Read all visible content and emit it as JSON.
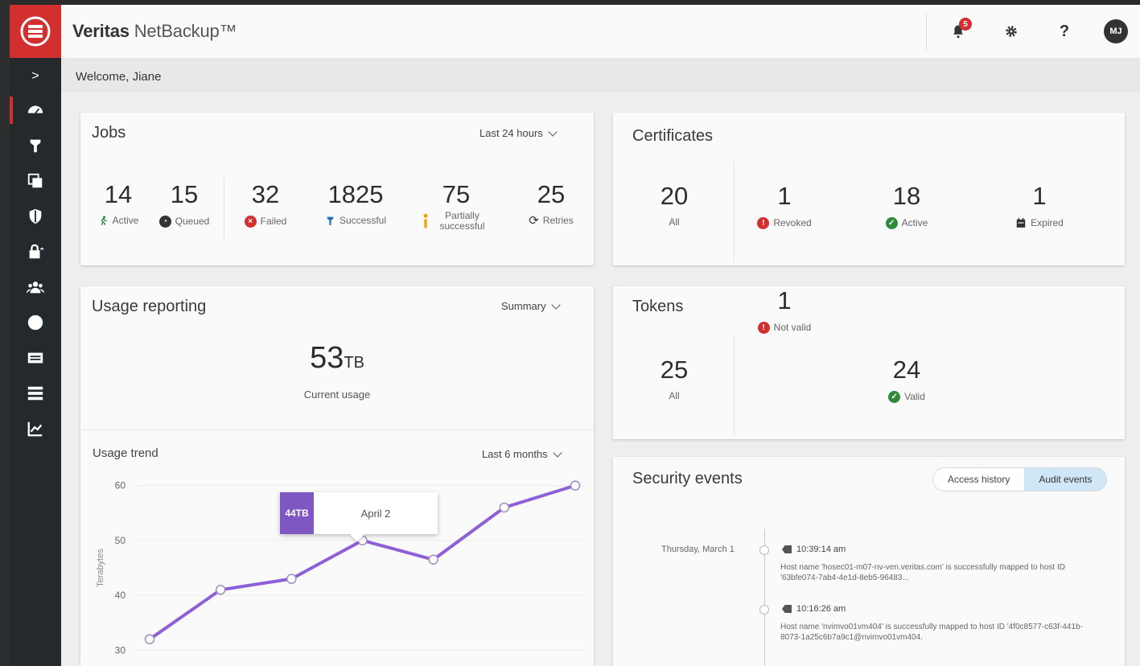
{
  "header": {
    "brand_bold": "Veritas",
    "brand_light": " NetBackup™",
    "notification_count": "5",
    "help_label": "?",
    "avatar_initials": "MJ"
  },
  "welcome": "Welcome, Jiane",
  "sidebar": {
    "expand_label": ">",
    "items": [
      "dashboard-icon",
      "jobs-icon",
      "clone-icon",
      "shield-icon",
      "lock-icon",
      "users-icon",
      "circle-icon",
      "storage-icon",
      "list-icon",
      "chart-icon"
    ]
  },
  "jobs": {
    "title": "Jobs",
    "range": "Last 24 hours",
    "stats": [
      {
        "value": "14",
        "label": "Active"
      },
      {
        "value": "15",
        "label": "Queued"
      },
      {
        "value": "32",
        "label": "Failed"
      },
      {
        "value": "1825",
        "label": "Successful"
      },
      {
        "value": "75",
        "label": "Partially successful"
      },
      {
        "value": "25",
        "label": "Retries"
      }
    ]
  },
  "certificates": {
    "title": "Certificates",
    "stats": [
      {
        "value": "20",
        "label": "All"
      },
      {
        "value": "1",
        "label": "Revoked"
      },
      {
        "value": "18",
        "label": "Active"
      },
      {
        "value": "1",
        "label": "Expired"
      }
    ]
  },
  "usage": {
    "title": "Usage reporting",
    "mode": "Summary",
    "current_value": "53",
    "current_unit": "TB",
    "current_label": "Current usage",
    "trend_title": "Usage trend",
    "trend_range": "Last 6 months",
    "tooltip_value": "44TB",
    "tooltip_date": "April 2"
  },
  "tokens": {
    "title": "Tokens",
    "stats": [
      {
        "value": "25",
        "label": "All"
      },
      {
        "value": "1",
        "label": "Not valid"
      },
      {
        "value": "24",
        "label": "Valid"
      }
    ]
  },
  "security": {
    "title": "Security events",
    "toggle": [
      "Access history",
      "Audit events"
    ],
    "date": "Thursday, March 1",
    "events": [
      {
        "time": "10:39:14 am",
        "text": "Host name 'hosec01-m07-nv-ven.veritas.com' is successfully mapped to host ID '63bfe074-7ab4-4e1d-8eb5-96483..."
      },
      {
        "time": "10:16:26 am",
        "text": "Host name 'nvimvo01vm404' is successfully mapped to host ID '4f0c8577-c63f-441b-8073-1a25c6b7a9c1@nvimvo01vm404."
      }
    ]
  },
  "chart_data": {
    "type": "line",
    "title": "Usage trend",
    "ylabel": "Terabytes",
    "xlabel": "",
    "ylim": [
      28,
      62
    ],
    "yticks": [
      30,
      40,
      50,
      60
    ],
    "x": [
      1,
      2,
      3,
      4,
      5,
      6,
      7
    ],
    "series": [
      {
        "values": [
          32,
          41,
          43,
          50,
          46.5,
          56,
          60
        ]
      }
    ],
    "color": "#8e5fd6"
  }
}
